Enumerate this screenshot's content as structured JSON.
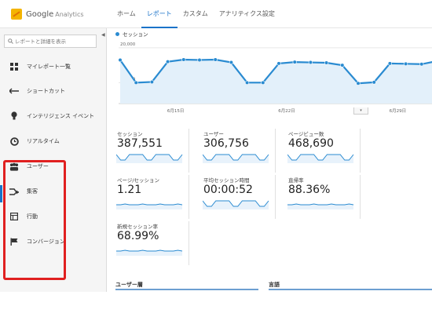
{
  "app": {
    "logo_title": "Google",
    "logo_subtitle": "Analytics"
  },
  "nav": {
    "tabs": [
      "ホーム",
      "レポート",
      "カスタム",
      "アナリティクス設定"
    ],
    "active_index": 1
  },
  "sidebar": {
    "search_placeholder": "レポートと詳細を表示",
    "items": [
      {
        "label": "マイレポート一覧",
        "icon": "grid-icon"
      },
      {
        "label": "ショートカット",
        "icon": "shortcut-arrow-icon"
      },
      {
        "label": "インテリジェンス イベント",
        "icon": "lightbulb-icon"
      },
      {
        "label": "リアルタイム",
        "icon": "clock-icon"
      },
      {
        "label": "ユーザー",
        "icon": "users-icon"
      },
      {
        "label": "集客",
        "icon": "acquisition-arrows-icon"
      },
      {
        "label": "行動",
        "icon": "behavior-page-icon"
      },
      {
        "label": "コンバージョン",
        "icon": "flag-icon"
      }
    ],
    "highlight_color": "#e02020"
  },
  "chart": {
    "legend_label": "セッション",
    "legend_color": "#2a8bd1",
    "y_ticks": [
      "20,000",
      "10,000"
    ],
    "x_ticks": [
      "6月15日",
      "6月22日",
      "6月29日"
    ]
  },
  "chart_data": {
    "type": "area",
    "series": [
      {
        "name": "セッション",
        "values": [
          16500,
          10000,
          10200,
          16000,
          16600,
          16500,
          16600,
          15800,
          10000,
          10000,
          15500,
          15900,
          15800,
          15700,
          15000,
          9800,
          10100,
          15500,
          15400,
          15300,
          16200
        ]
      }
    ],
    "ylim": [
      4000,
      22000
    ],
    "yticks": [
      20000,
      10000
    ],
    "x_labels": [
      "6月15日",
      "6月22日",
      "6月29日"
    ],
    "grid": true
  },
  "metrics": [
    {
      "label": "セッション",
      "value": "387,551"
    },
    {
      "label": "ユーザー",
      "value": "306,756"
    },
    {
      "label": "ページビュー数",
      "value": "468,690"
    },
    {
      "label": "ページ/セッション",
      "value": "1.21"
    },
    {
      "label": "平均セッション時間",
      "value": "00:00:52"
    },
    {
      "label": "直帰率",
      "value": "88.36%"
    },
    {
      "label": "新規セッション率",
      "value": "68.99%"
    }
  ],
  "sections": {
    "age": "ユーザー層",
    "language": "言語"
  },
  "colors": {
    "accent": "#1a73c9",
    "line": "#2a8bd1",
    "area": "#e3f0fa"
  }
}
